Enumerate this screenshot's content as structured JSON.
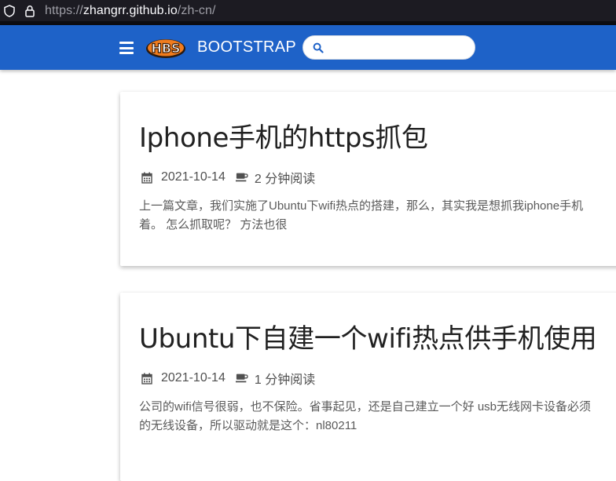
{
  "browser": {
    "url_scheme": "https://",
    "url_host": "zhangrr.github.io",
    "url_path": "/zh-cn/"
  },
  "navbar": {
    "brand": "BOOTSTRAP",
    "logo_alt": "HBS",
    "search_placeholder": "",
    "colors": {
      "navbar_bg": "#1e62c8",
      "logo_orange": "#f07c1e"
    }
  },
  "posts": [
    {
      "title": "Iphone手机的https抓包",
      "date": "2021-10-14",
      "read_time": "2 分钟阅读",
      "summary_lines": [
        "上一篇文章，我们实施了Ubuntu下wifi热点的搭建，那么，其实我是想抓我iphone手机",
        "着。 怎么抓取呢？ 方法也很"
      ]
    },
    {
      "title": "Ubuntu下自建一个wifi热点供手机使用",
      "date": "2021-10-14",
      "read_time": "1 分钟阅读",
      "summary_lines": [
        "公司的wifi信号很弱，也不保险。省事起见，还是自己建立一个好 usb无线网卡设备必须",
        "的无线设备，所以驱动就是这个：nl80211"
      ]
    }
  ]
}
